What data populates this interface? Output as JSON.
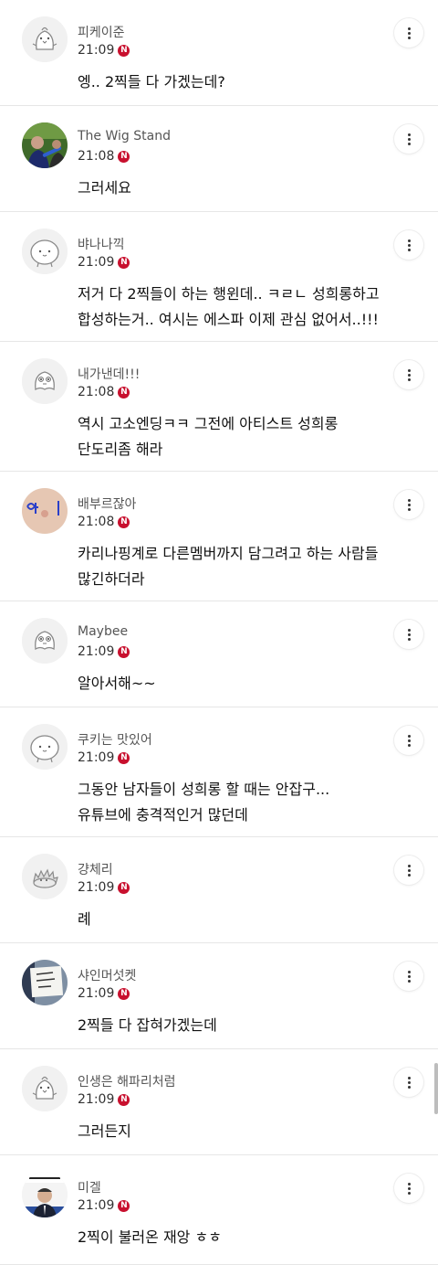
{
  "comments": [
    {
      "author": "피케이준",
      "time": "21:09",
      "badge": "N",
      "lines": [
        "엥.. 2찍들 다 가겠는데?"
      ],
      "avatar": "chick-icon"
    },
    {
      "author": "The Wig Stand",
      "time": "21:08",
      "badge": "N",
      "lines": [
        "그러세요"
      ],
      "avatar": "profile-photo"
    },
    {
      "author": "뱌나나끽",
      "time": "21:09",
      "badge": "N",
      "lines": [
        "저거 다 2찍들이 하는 행윈데.. ㅋㄹㄴ 성희롱하고",
        "합성하는거.. 여시는 에스파 이제 관심 없어서..!!!"
      ],
      "avatar": "bun-icon"
    },
    {
      "author": "내가낸데!!!",
      "time": "21:08",
      "badge": "N",
      "lines": [
        "역시 고소엔딩ㅋㅋ 그전에 아티스트 성희롱",
        "단도리좀 해라"
      ],
      "avatar": "ghost-icon"
    },
    {
      "author": "배부르잖아",
      "time": "21:08",
      "badge": "N",
      "lines": [
        "카리나핑계로 다른멤버까지 담그려고 하는 사람들",
        "많긴하더라"
      ],
      "avatar": "handwriting-photo"
    },
    {
      "author": "Maybee",
      "time": "21:09",
      "badge": "N",
      "lines": [
        "알아서해~~"
      ],
      "avatar": "ghost-icon"
    },
    {
      "author": "쿠키는 맛있어",
      "time": "21:09",
      "badge": "N",
      "lines": [
        "그동안 남자들이 성희롱 할 때는 안잡구...",
        "유튜브에 충격적인거 많던데"
      ],
      "avatar": "bun-icon"
    },
    {
      "author": "걍체리",
      "time": "21:09",
      "badge": "N",
      "lines": [
        "례"
      ],
      "avatar": "hedgehog-icon"
    },
    {
      "author": "샤인머섯켓",
      "time": "21:09",
      "badge": "N",
      "lines": [
        "2찍들 다 잡혀가겠는데"
      ],
      "avatar": "sign-photo"
    },
    {
      "author": "인생은 해파리처럼",
      "time": "21:09",
      "badge": "N",
      "lines": [
        "그러든지"
      ],
      "avatar": "chick-icon"
    },
    {
      "author": "미겔",
      "time": "21:09",
      "badge": "N",
      "lines": [
        "2찍이 불러온 재앙 ㅎㅎ"
      ],
      "avatar": "poster-photo"
    }
  ],
  "colors": {
    "badge": "#c8102e",
    "divider": "#e6e6e6",
    "author": "#555555",
    "body": "#111111"
  }
}
